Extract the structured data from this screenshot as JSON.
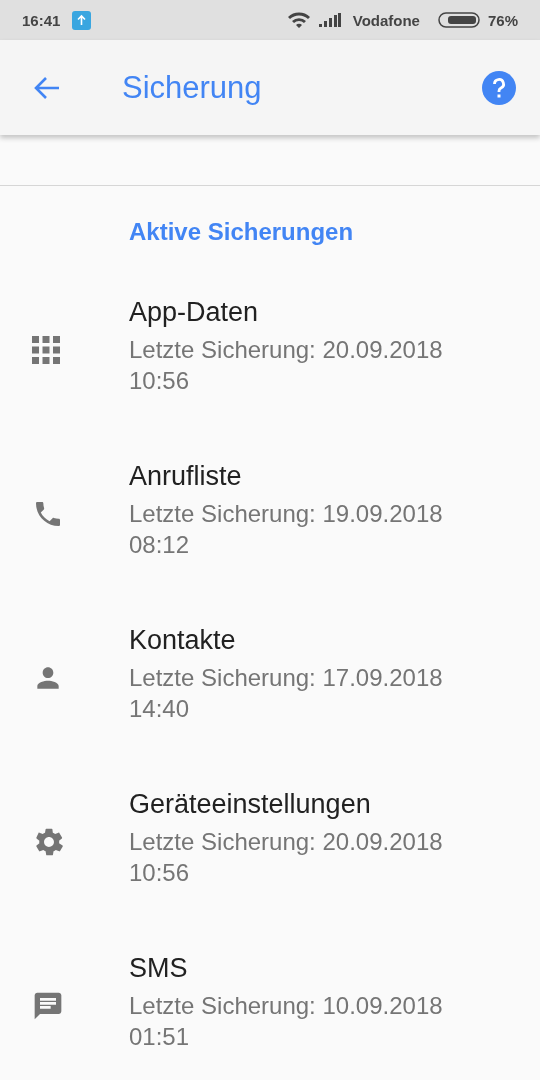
{
  "status_bar": {
    "time": "16:41",
    "carrier": "Vodafone",
    "battery": "76%"
  },
  "app_bar": {
    "title": "Sicherung"
  },
  "section": {
    "title": "Aktive Sicherungen"
  },
  "items": [
    {
      "kind": "apps",
      "title": "App-Daten",
      "subtitle": "Letzte Sicherung: 20.09.2018 10:56"
    },
    {
      "kind": "phone",
      "title": "Anrufliste",
      "subtitle": "Letzte Sicherung: 19.09.2018 08:12"
    },
    {
      "kind": "person",
      "title": "Kontakte",
      "subtitle": "Letzte Sicherung: 17.09.2018 14:40"
    },
    {
      "kind": "settings",
      "title": "Geräteeinstellungen",
      "subtitle": "Letzte Sicherung: 20.09.2018 10:56"
    },
    {
      "kind": "message",
      "title": "SMS",
      "subtitle": "Letzte Sicherung: 10.09.2018 01:51"
    }
  ]
}
